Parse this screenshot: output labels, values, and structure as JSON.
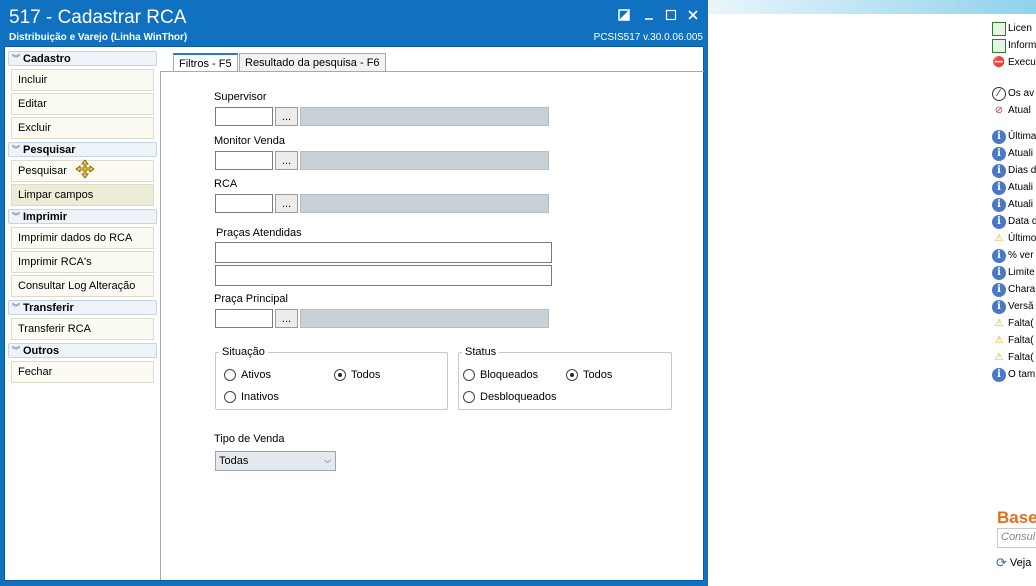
{
  "window": {
    "title": "517 - Cadastrar RCA",
    "subtitle": "Distribuição e Varejo (Linha WinThor)",
    "version": "PCSIS517  v.30.0.06.005"
  },
  "sidebar": {
    "groups": [
      {
        "label": "Cadastro",
        "items": [
          "Incluir",
          "Editar",
          "Excluir"
        ]
      },
      {
        "label": "Pesquisar",
        "items": [
          "Pesquisar",
          "Limpar campos"
        ]
      },
      {
        "label": "Imprimir",
        "items": [
          "Imprimir dados do RCA",
          "Imprimir RCA's",
          "Consultar Log Alteração"
        ]
      },
      {
        "label": "Transferir",
        "items": [
          "Transferir RCA"
        ]
      },
      {
        "label": "Outros",
        "items": [
          "Fechar"
        ]
      }
    ]
  },
  "tabs": [
    "Filtros - F5",
    "Resultado da pesquisa - F6"
  ],
  "filters": {
    "supervisor_label": "Supervisor",
    "monitor_label": "Monitor Venda",
    "rca_label": "RCA",
    "pracas_label": "Praças Atendidas",
    "praca_principal_label": "Praça Principal",
    "lookup_button": "...",
    "situacao": {
      "legend": "Situação",
      "opt_ativos": "Ativos",
      "opt_todos": "Todos",
      "opt_inativos": "Inativos",
      "selected": "Todos"
    },
    "status": {
      "legend": "Status",
      "opt_bloqueados": "Bloqueados",
      "opt_todos": "Todos",
      "opt_desbloqueados": "Desbloqueados",
      "selected": "Todos"
    },
    "tipo_venda_label": "Tipo de Venda",
    "tipo_venda_value": "Todas"
  },
  "background_app": {
    "rows": [
      {
        "icon": "license-icon",
        "text": "Licen"
      },
      {
        "icon": "license-icon",
        "text": "Inform"
      },
      {
        "icon": "execute-icon",
        "text": "Execu"
      },
      {
        "icon": "clock-icon",
        "text": "Os av"
      },
      {
        "icon": "refresh-icon",
        "text": "Atual"
      },
      {
        "icon": "info-icon",
        "text": "Última"
      },
      {
        "icon": "info-icon",
        "text": "Atuali"
      },
      {
        "icon": "info-icon",
        "text": "Dias d"
      },
      {
        "icon": "info-icon",
        "text": "Atuali"
      },
      {
        "icon": "info-icon",
        "text": "Atuali"
      },
      {
        "icon": "info-icon",
        "text": "Data d"
      },
      {
        "icon": "warning-icon",
        "text": "Último"
      },
      {
        "icon": "info-icon",
        "text": "% ver"
      },
      {
        "icon": "info-icon",
        "text": "Limite"
      },
      {
        "icon": "info-icon",
        "text": "Chara"
      },
      {
        "icon": "info-icon",
        "text": "Versã"
      },
      {
        "icon": "warning-icon",
        "text": "Falta("
      },
      {
        "icon": "warning-icon",
        "text": "Falta("
      },
      {
        "icon": "warning-icon",
        "text": "Falta("
      },
      {
        "icon": "info-icon",
        "text": "O tam"
      }
    ],
    "brand": "Base",
    "search_placeholder": "Consul",
    "footer_link": "Veja"
  },
  "colors": {
    "titlebar": "#0f71c0",
    "accent_tab": "#2a78c8",
    "brand": "#e07020"
  }
}
